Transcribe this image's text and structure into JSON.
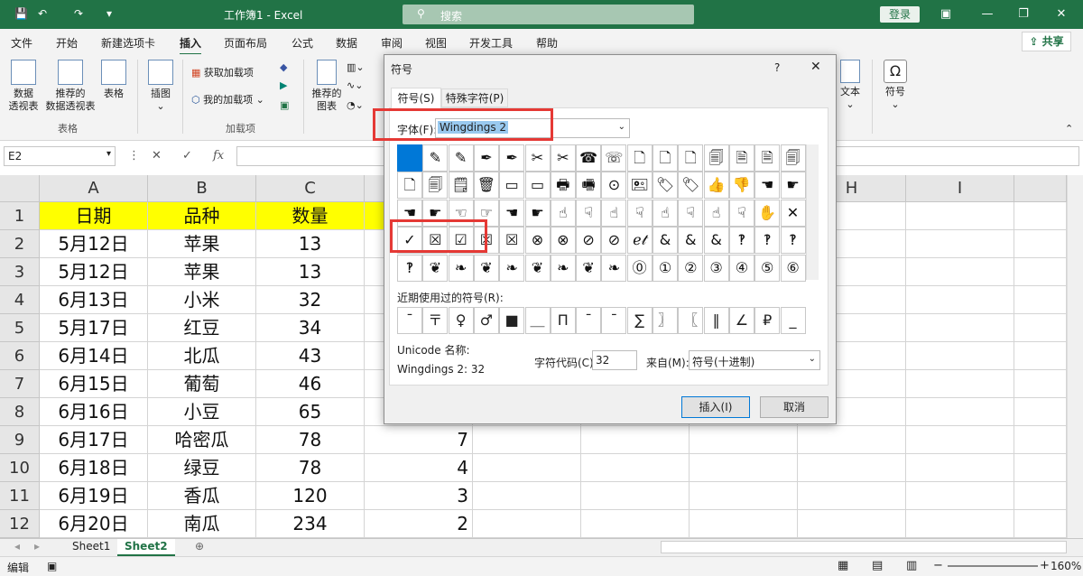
{
  "titlebar": {
    "title": "工作簿1  -  Excel",
    "search_placeholder": "搜索",
    "login": "登录",
    "colors": {
      "bar": "#217346"
    }
  },
  "menu": {
    "items": [
      "文件",
      "开始",
      "新建选项卡",
      "插入",
      "页面布局",
      "公式",
      "数据",
      "审阅",
      "视图",
      "开发工具",
      "帮助"
    ],
    "active": "插入",
    "share": "共享"
  },
  "ribbon": {
    "pivot": "数据\n透视表",
    "recommended_pivot": "推荐的\n数据透视表",
    "table": "表格",
    "group_table": "表格",
    "illustrations": "插图",
    "get_addins": "获取加载项",
    "my_addins": "我的加载项",
    "group_addins": "加载项",
    "recommended_charts": "推荐的\n图表",
    "text": "文本",
    "symbols": "符号"
  },
  "formula_bar": {
    "name_box": "E2",
    "value": ""
  },
  "grid": {
    "columns": [
      "A",
      "B",
      "C",
      "D",
      "E",
      "F",
      "G",
      "H",
      "I"
    ],
    "visible_col_labels": [
      "A",
      "B",
      "C",
      "",
      "",
      "",
      "",
      "H",
      "I"
    ],
    "rows": [
      "1",
      "2",
      "3",
      "4",
      "5",
      "6",
      "7",
      "8",
      "9",
      "10",
      "11",
      "12"
    ],
    "headers": [
      "日期",
      "品种",
      "数量"
    ],
    "data": [
      [
        "5月12日",
        "苹果",
        "13",
        ""
      ],
      [
        "5月12日",
        "苹果",
        "13",
        ""
      ],
      [
        "6月13日",
        "小米",
        "32",
        ""
      ],
      [
        "5月17日",
        "红豆",
        "34",
        ""
      ],
      [
        "6月14日",
        "北瓜",
        "43",
        ""
      ],
      [
        "6月15日",
        "葡萄",
        "46",
        ""
      ],
      [
        "6月16日",
        "小豆",
        "65",
        ""
      ],
      [
        "6月17日",
        "哈密瓜",
        "78",
        "7"
      ],
      [
        "6月18日",
        "绿豆",
        "78",
        "4"
      ],
      [
        "6月19日",
        "香瓜",
        "120",
        "3"
      ],
      [
        "6月20日",
        "南瓜",
        "234",
        "2"
      ]
    ],
    "header_color": "#ffff00"
  },
  "sheets": {
    "tabs": [
      "Sheet1",
      "Sheet2"
    ],
    "active": "Sheet2"
  },
  "status": {
    "mode": "编辑",
    "zoom": "160%"
  },
  "dialog": {
    "title": "符号",
    "help": "?",
    "close": "✕",
    "tab_symbols": "符号(S)",
    "tab_special": "特殊字符(P)",
    "font_label": "字体(F):",
    "font_value": "Wingdings 2",
    "symbols": [
      [
        "",
        "✎",
        "✎",
        "✒",
        "✒",
        "✂",
        "✂",
        "☎",
        "☏",
        "🗋",
        "🗋",
        "🗋",
        "🗐",
        "🗎",
        "🗎",
        "🗐",
        "🗋"
      ],
      [
        "🗋",
        "🗐",
        "🗒",
        "🗑",
        "▭",
        "▭",
        "🖶",
        "🖷",
        "⊙",
        "🖭",
        "🏷",
        "🏷",
        "👍",
        "👎",
        "☚",
        "☛"
      ],
      [
        "☚",
        "☛",
        "☜",
        "☞",
        "☚",
        "☛",
        "☝",
        "☟",
        "☝",
        "☟",
        "☝",
        "☟",
        "☝",
        "☟",
        "✋",
        "✕"
      ],
      [
        "✓",
        "☒",
        "☑",
        "☒",
        "☒",
        "⊗",
        "⊗",
        "⊘",
        "⊘",
        "ℯ𝓉",
        "&",
        "&",
        "&",
        "‽",
        "‽",
        "‽"
      ],
      [
        "‽",
        "❦",
        "❧",
        "❦",
        "❧",
        "❦",
        "❧",
        "❦",
        "❧",
        "⓪",
        "①",
        "②",
        "③",
        "④",
        "⑤",
        "⑥"
      ]
    ],
    "recent_label": "近期使用过的符号(R):",
    "recent": [
      "ˉ",
      "〒",
      "♀",
      "♂",
      "■",
      "＿",
      "Π",
      "ˉ",
      "ˉ",
      "∑",
      "〗",
      "〖",
      "‖",
      "∠",
      "₽",
      "_"
    ],
    "unicode_name_label": "Unicode 名称:",
    "unicode_name_value": "Wingdings 2: 32",
    "code_label": "字符代码(C):",
    "code_value": "32",
    "from_label": "来自(M):",
    "from_value": "符号(十进制)",
    "insert": "插入(I)",
    "cancel": "取消"
  }
}
